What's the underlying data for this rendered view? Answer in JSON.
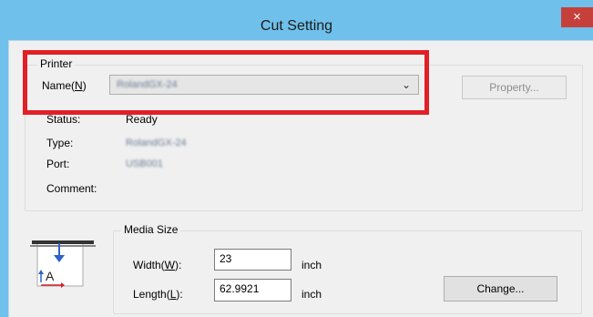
{
  "window": {
    "title": "Cut Setting",
    "close_glyph": "×"
  },
  "printer": {
    "group_label": "Printer",
    "name_label": "Name(",
    "name_mnemonic": "N",
    "name_suffix": ")",
    "name_value": "RolandGX-24",
    "property_button": "Property...",
    "status_label": "Status:",
    "status_value": "Ready",
    "type_label": "Type:",
    "type_value": "RolandGX-24",
    "port_label": "Port:",
    "port_value": "USB001",
    "comment_label": "Comment:"
  },
  "media": {
    "group_label": "Media Size",
    "width_label": "Width(",
    "width_mnemonic": "W",
    "width_suffix": "):",
    "width_value": "23",
    "width_unit": "inch",
    "length_label": "Length(",
    "length_mnemonic": "L",
    "length_suffix": "):",
    "length_value": "62.9921",
    "length_unit": "inch",
    "change_button": "Change..."
  },
  "icons": [
    "close-icon",
    "chevron-down-icon",
    "media-size-icon"
  ],
  "colors": {
    "titlebar": "#6fc0ea",
    "close": "#c6403b",
    "highlight": "#e21f26"
  }
}
